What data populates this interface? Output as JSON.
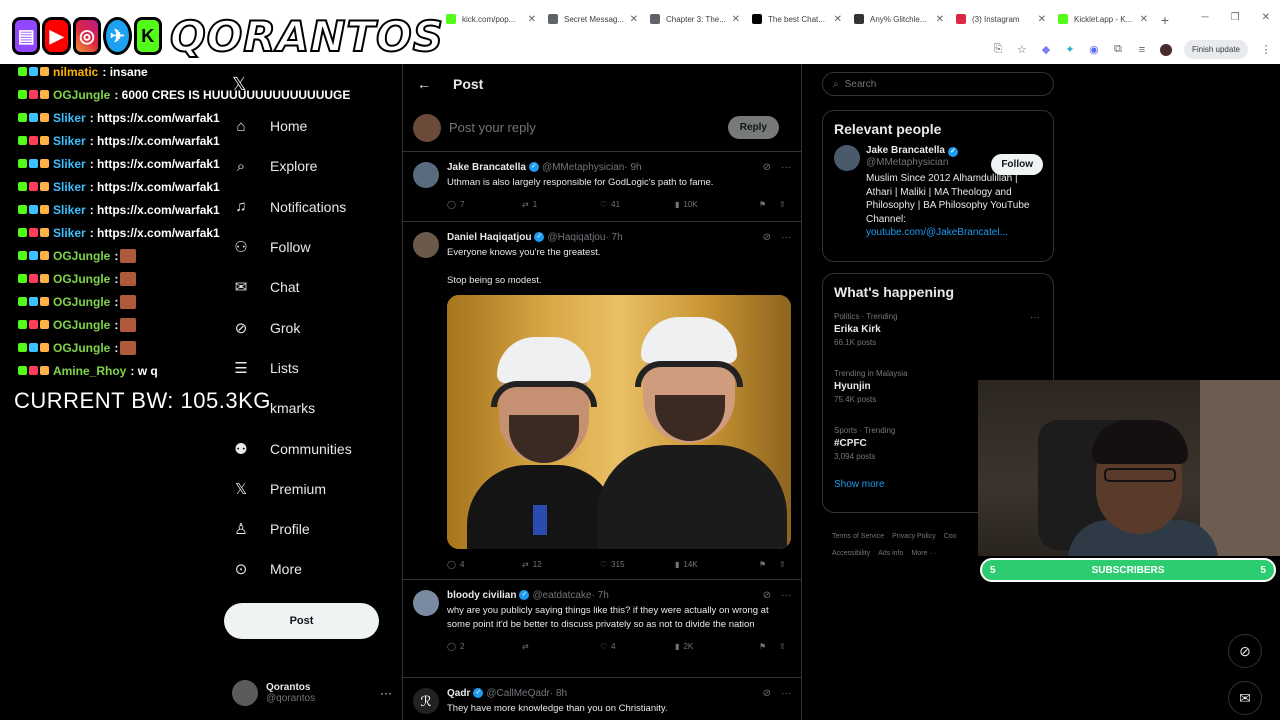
{
  "browser": {
    "tabs": [
      {
        "label": "kick.com/pop...",
        "color": "#53fc18"
      },
      {
        "label": "Secret Messag...",
        "color": "#5f6368"
      },
      {
        "label": "Chapter 3: The...",
        "color": "#5f6368"
      },
      {
        "label": "The best Chat...",
        "color": "#000000"
      },
      {
        "label": "Any% Glitchle...",
        "color": "#333333"
      },
      {
        "label": "(3) Instagram",
        "color": "#dc2743"
      },
      {
        "label": "Kicklet.app - K...",
        "color": "#53fc18"
      }
    ],
    "finish_update": "Finish update"
  },
  "overlay": {
    "brand": "QORANTOS",
    "platforms": [
      "twitch",
      "youtube",
      "instagram",
      "twitter",
      "kick"
    ],
    "chat": [
      {
        "user": "nilmatic",
        "text": ": insane",
        "color": "#ffb300",
        "emote": false
      },
      {
        "user": "OGJungle",
        "text": ": 6000 CRES IS HUUUUUUUUUUUUUUGE",
        "color": "#7fd44a",
        "emote": false
      },
      {
        "user": "Sliker",
        "text": ": https://x.com/warfak1",
        "color": "#3cc0ff",
        "emote": false
      },
      {
        "user": "Sliker",
        "text": ": https://x.com/warfak1",
        "color": "#3cc0ff",
        "emote": false
      },
      {
        "user": "Sliker",
        "text": ": https://x.com/warfak1",
        "color": "#3cc0ff",
        "emote": false
      },
      {
        "user": "Sliker",
        "text": ": https://x.com/warfak1",
        "color": "#3cc0ff",
        "emote": false
      },
      {
        "user": "Sliker",
        "text": ": https://x.com/warfak1",
        "color": "#3cc0ff",
        "emote": false
      },
      {
        "user": "Sliker",
        "text": ": https://x.com/warfak1",
        "color": "#3cc0ff",
        "emote": false
      },
      {
        "user": "OGJungle",
        "text": " :",
        "color": "#7fd44a",
        "emote": true
      },
      {
        "user": "OGJungle",
        "text": " :",
        "color": "#7fd44a",
        "emote": true
      },
      {
        "user": "OGJungle",
        "text": " :",
        "color": "#7fd44a",
        "emote": true
      },
      {
        "user": "OGJungle",
        "text": " :",
        "color": "#7fd44a",
        "emote": true
      },
      {
        "user": "OGJungle",
        "text": " :",
        "color": "#7fd44a",
        "emote": true
      },
      {
        "user": "Amine_Rhoy",
        "text": ": w q",
        "color": "#7fd44a",
        "emote": false
      }
    ],
    "bodyweight": "CURRENT BW: 105.3KG",
    "subscribers": {
      "label": "SUBSCRIBERS",
      "left": "5",
      "right": "5"
    }
  },
  "nav": {
    "items": [
      {
        "label": "Home",
        "icon": "home-icon",
        "glyph": "⌂"
      },
      {
        "label": "Explore",
        "icon": "search-icon",
        "glyph": "⌕"
      },
      {
        "label": "Notifications",
        "icon": "bell-icon",
        "glyph": "♫"
      },
      {
        "label": "Follow",
        "icon": "person-plus-icon",
        "glyph": "⚇"
      },
      {
        "label": "Chat",
        "icon": "mail-icon",
        "glyph": "✉"
      },
      {
        "label": "Grok",
        "icon": "grok-icon",
        "glyph": "⊘"
      },
      {
        "label": "Lists",
        "icon": "list-icon",
        "glyph": "☰"
      },
      {
        "label": "kmarks",
        "icon": "bookmark-icon",
        "glyph": ""
      },
      {
        "label": "Communities",
        "icon": "people-icon",
        "glyph": "⚉"
      },
      {
        "label": "Premium",
        "icon": "x-logo-icon",
        "glyph": "𝕏"
      },
      {
        "label": "Profile",
        "icon": "profile-icon",
        "glyph": "♙"
      },
      {
        "label": "More",
        "icon": "more-circle-icon",
        "glyph": "⊙"
      }
    ],
    "post_button": "Post",
    "account": {
      "name": "Qorantos",
      "handle": "@qorantos"
    }
  },
  "main": {
    "title": "Post",
    "reply_placeholder": "Post your reply",
    "reply_button": "Reply",
    "tweets": [
      {
        "name": "Jake Brancatella",
        "handle": "@MMetaphysician",
        "time": "· 9h",
        "text": "Uthman is also largely responsible for GodLogic's path to fame.",
        "replies": "7",
        "reposts": "1",
        "likes": "41",
        "views": "10K",
        "avatar_color": "#5a6b80"
      },
      {
        "name": "Daniel Haqiqatjou",
        "handle": "@Haqiqatjou",
        "time": "· 7h",
        "text": "Everyone knows you're the greatest.",
        "text2": "Stop being so modest.",
        "replies": "4",
        "reposts": "12",
        "likes": "315",
        "views": "14K",
        "avatar_color": "#6b5a4a"
      },
      {
        "name": "bloody civilian",
        "handle": "@eatdatcake",
        "time": "· 7h",
        "text": "why are you publicly saying things like this? if they were actually on wrong at some point it'd be better to discuss privately so as not to divide the nation",
        "replies": "2",
        "reposts": "",
        "likes": "4",
        "views": "2K",
        "avatar_color": "#7a8aa0"
      },
      {
        "name": "Qadr",
        "handle": "@CallMeQadr",
        "time": "· 8h",
        "text": "They have more knowledge than you on Christianity.",
        "avatar_color": "#222222"
      }
    ]
  },
  "sidebar": {
    "search_placeholder": "Search",
    "relevant": {
      "title": "Relevant people",
      "name": "Jake Brancatella",
      "handle": "@MMetaphysician",
      "bio": "Muslim Since 2012 Alhamdulillah | Athari | Maliki | MA Theology and Philosophy | BA Philosophy YouTube Channel:",
      "link": "youtube.com/@JakeBrancatel...",
      "follow": "Follow"
    },
    "happening": {
      "title": "What's happening",
      "trends": [
        {
          "category": "Politics · Trending",
          "topic": "Erika Kirk",
          "count": "66.1K posts"
        },
        {
          "category": "Trending in Malaysia",
          "topic": "Hyunjin",
          "count": "75.4K posts"
        },
        {
          "category": "Sports · Trending",
          "topic": "#CPFC",
          "count": "3,094 posts"
        }
      ],
      "show_more": "Show more"
    },
    "footer": [
      "Terms of Service",
      "Privacy Policy",
      "Coo",
      "Accessibility",
      "Ads info",
      "More ···"
    ]
  }
}
